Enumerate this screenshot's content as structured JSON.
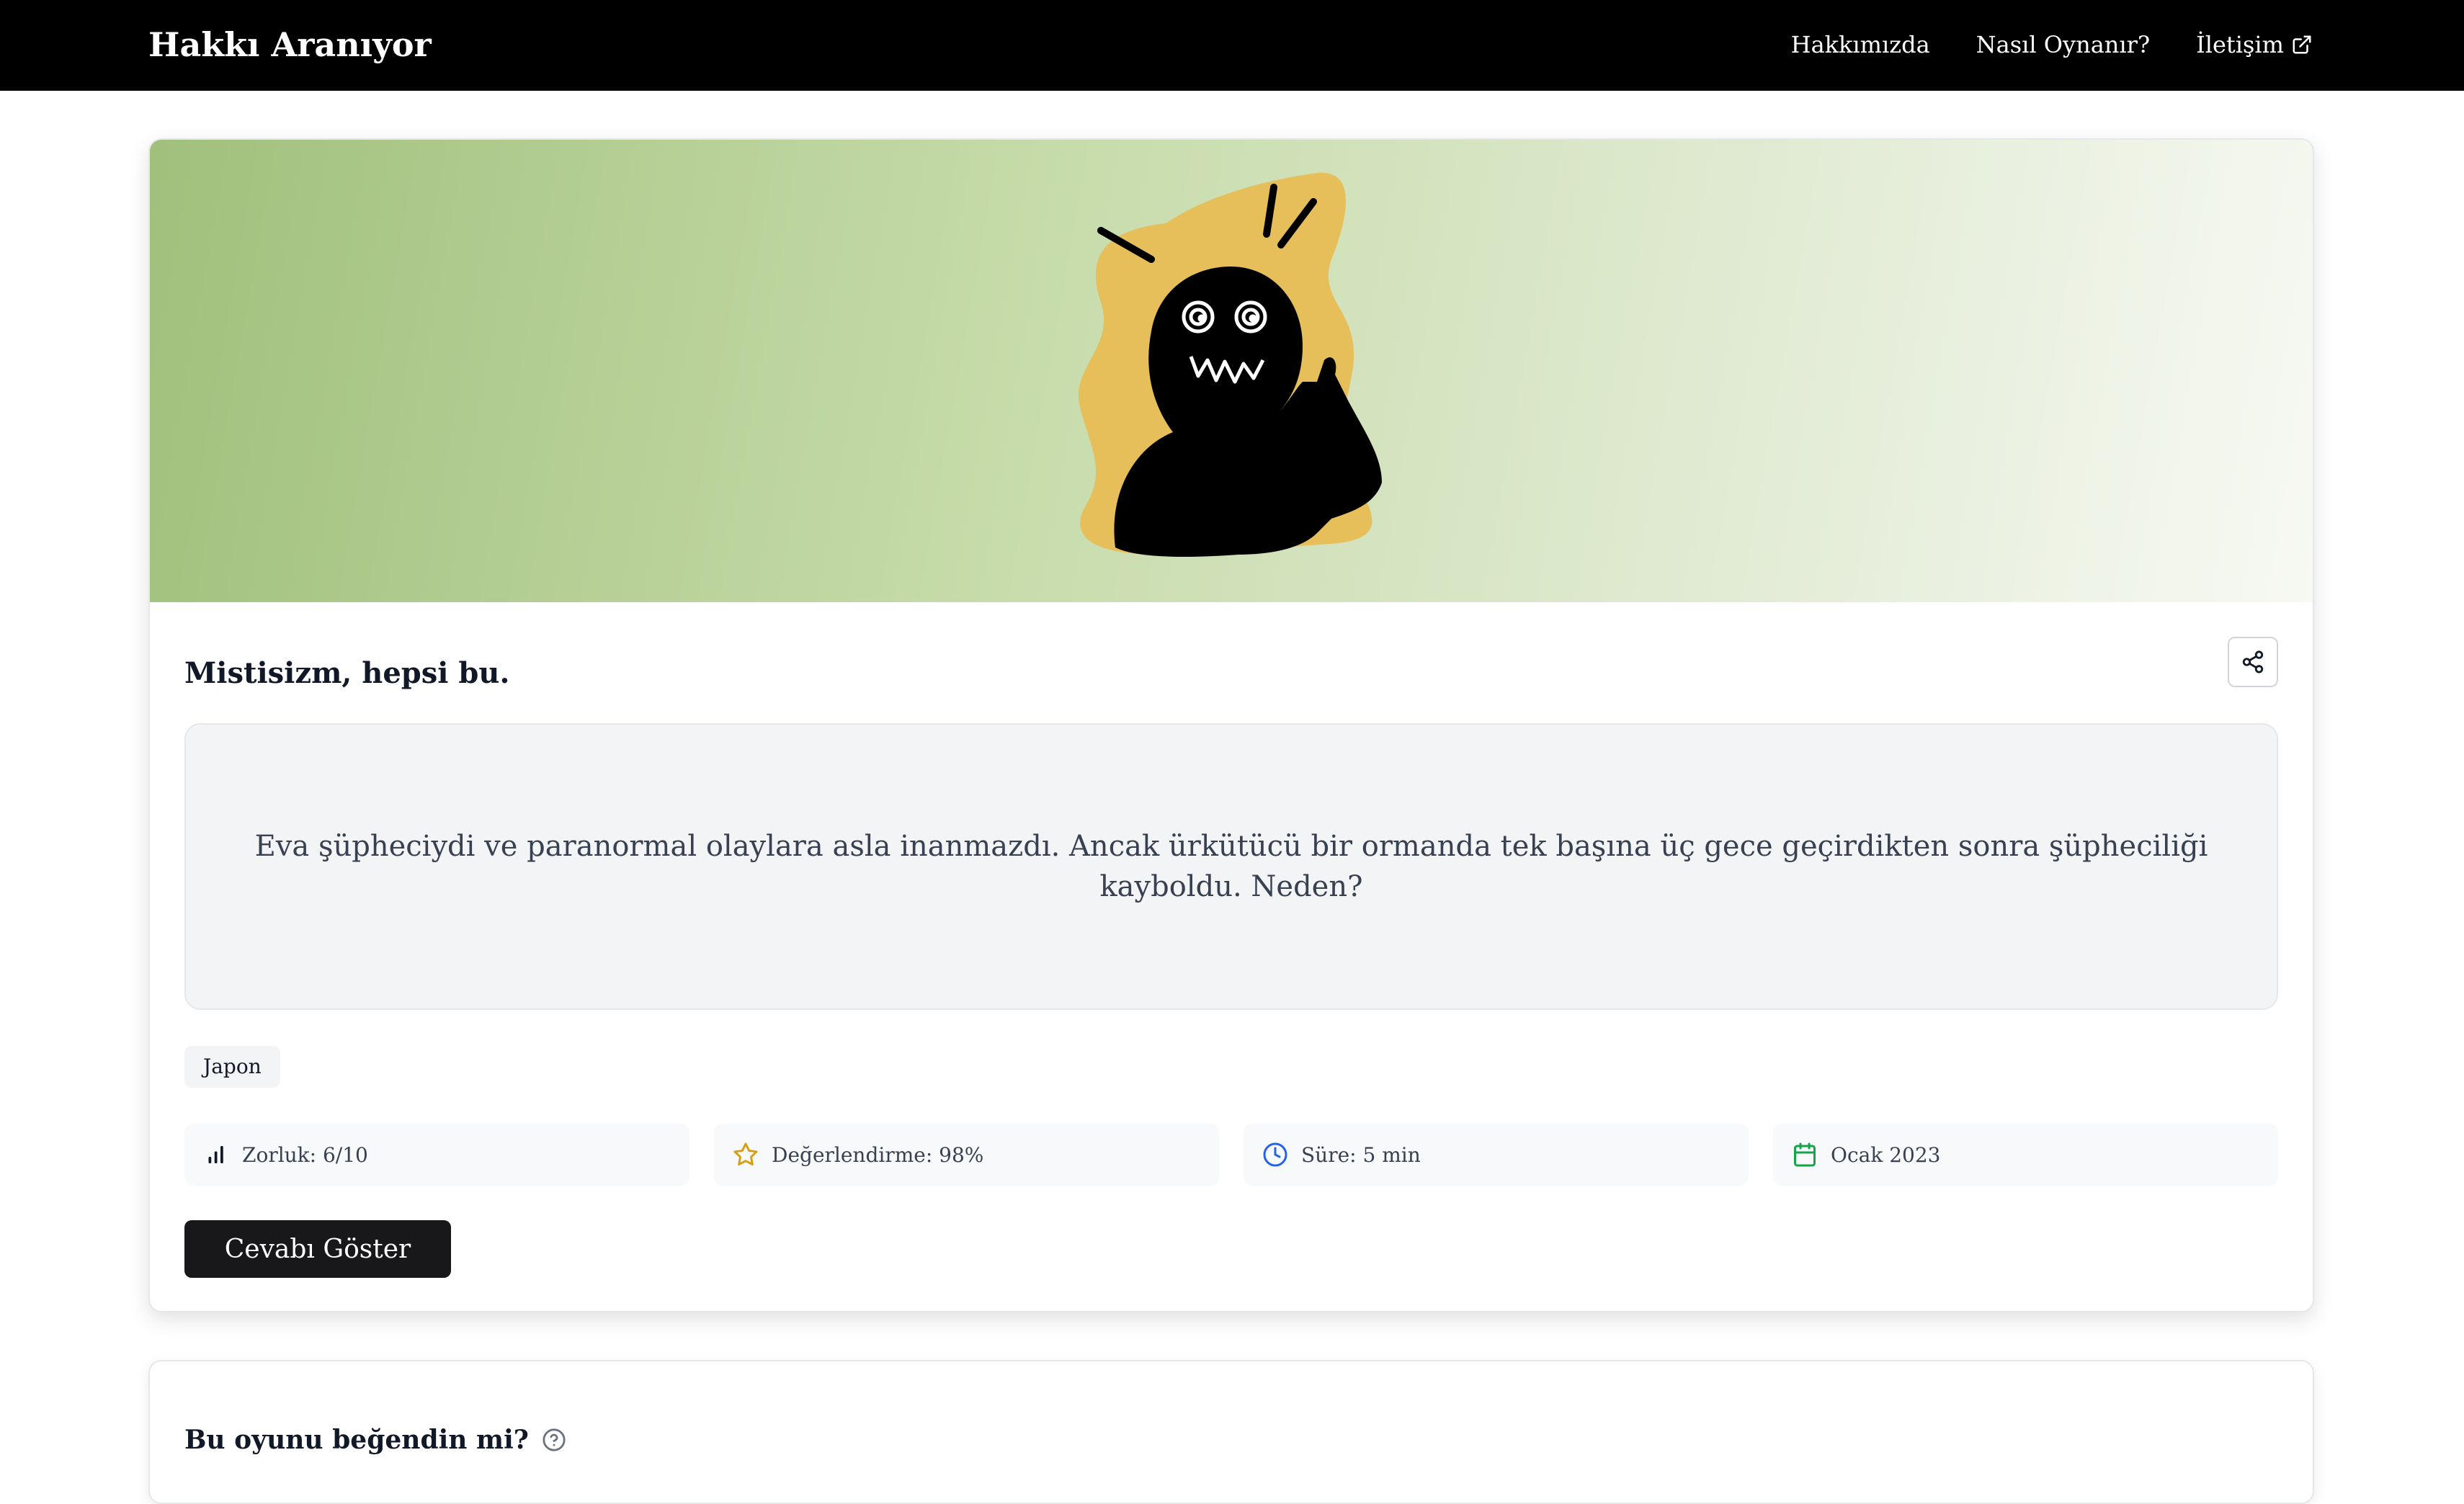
{
  "header": {
    "brand": "Hakkı Aranıyor",
    "nav": [
      {
        "label": "Hakkımızda"
      },
      {
        "label": "Nasıl Oynanır?"
      },
      {
        "label": "İletişim",
        "icon": "external-link-icon"
      }
    ]
  },
  "puzzle": {
    "title": "Mistisizm, hepsi bu.",
    "question": "Eva şüpheciydi ve paranormal olaylara asla inanmazdı. Ancak ürkütücü bir ormanda tek başına üç gece geçirdikten sonra şüpheciliği kayboldu. Neden?",
    "tag": "Japon",
    "stats": {
      "difficulty": "Zorluk: 6/10",
      "rating": "Değerlendirme: 98%",
      "duration": "Süre: 5 min",
      "date": "Ocak 2023"
    },
    "answer_button": "Cevabı Göster",
    "illustration": "dizzy-silhouette-illustration"
  },
  "feedback": {
    "title": "Bu oyunu beğendin mi?"
  },
  "colors": {
    "navbar": "#000000",
    "accent_yellow": "#e6be5a",
    "hero_green": "#a0c07c",
    "button_dark": "#18181b",
    "rating_star": "#d4a017",
    "clock_blue": "#2563eb",
    "calendar_green": "#16a34a"
  }
}
